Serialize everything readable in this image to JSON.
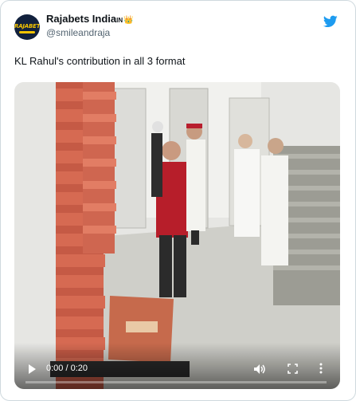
{
  "tweet": {
    "author_name": "Rajabets India",
    "author_badge": "IN",
    "crown_icon": "crown-icon",
    "handle": "@smileandraja",
    "avatar_text": "RAJABETS",
    "text": "KL Rahul's contribution in all 3 format",
    "brand_icon": "twitter-bird-icon"
  },
  "video": {
    "time_display": "0:00 / 0:20",
    "progress_fraction": 0,
    "controls": [
      "play-icon",
      "volume-icon",
      "fullscreen-icon",
      "more-options-icon"
    ]
  },
  "colors": {
    "twitter_blue": "#1d9bf0",
    "avatar_bg": "#12213d",
    "avatar_accent": "#f5c400"
  }
}
